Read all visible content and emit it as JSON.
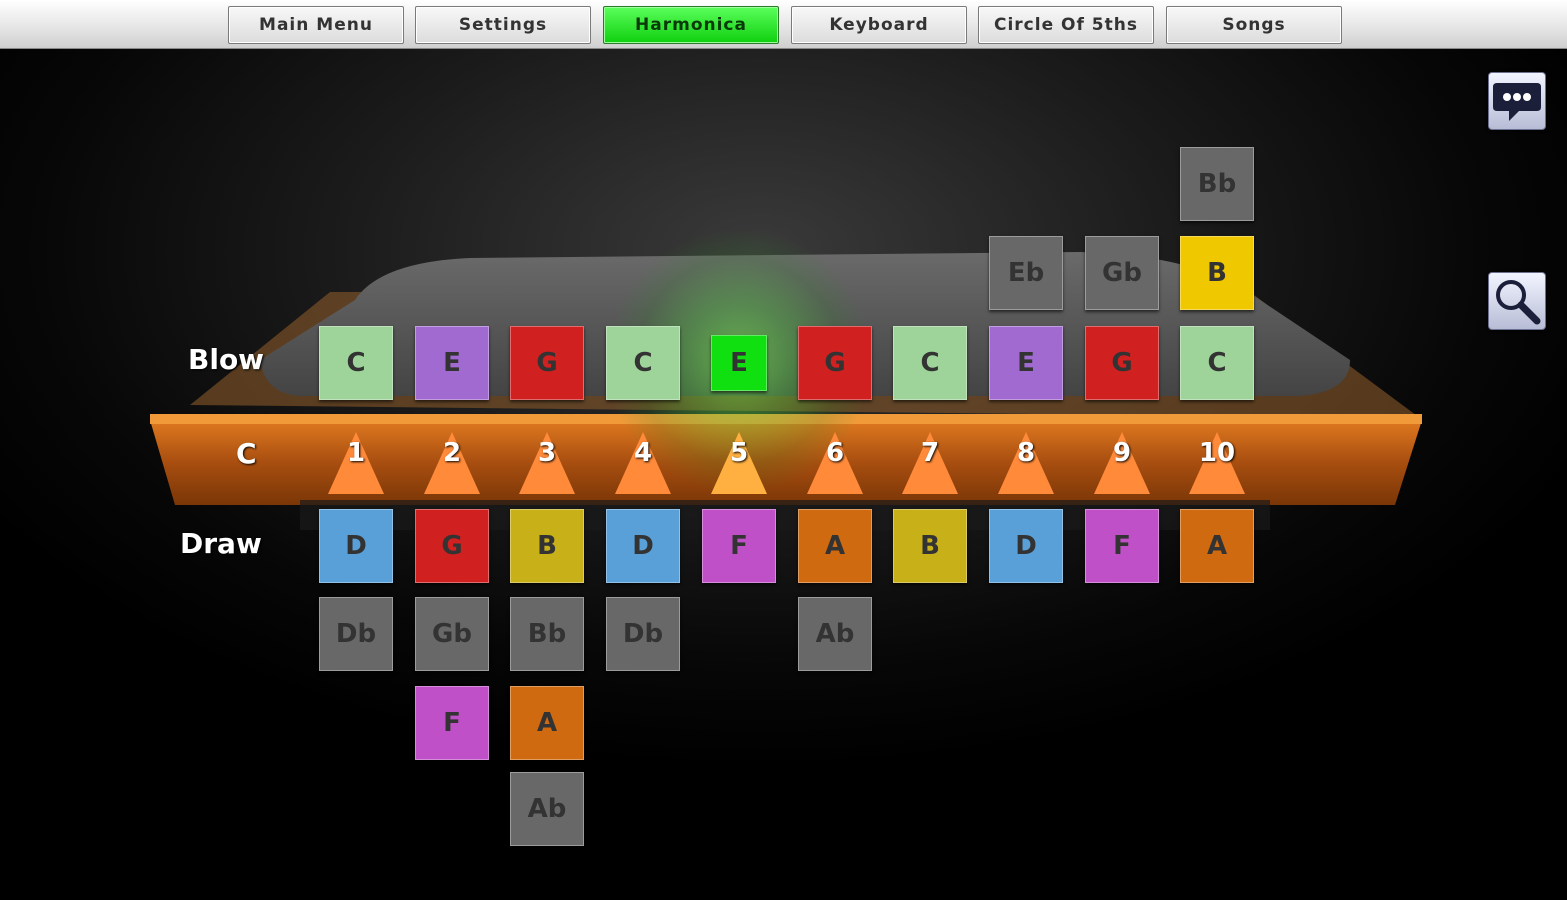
{
  "nav": {
    "buttons": [
      {
        "label": "Main Menu",
        "active": false
      },
      {
        "label": "Settings",
        "active": false
      },
      {
        "label": "Harmonica",
        "active": true
      },
      {
        "label": "Keyboard",
        "active": false
      },
      {
        "label": "Circle Of 5ths",
        "active": false
      },
      {
        "label": "Songs",
        "active": false
      }
    ]
  },
  "side_icons": {
    "chat": "speech-bubble-icon",
    "zoom": "magnifier-icon"
  },
  "harmonica": {
    "key": "C",
    "blow_label": "Blow",
    "draw_label": "Draw",
    "active_hole": 5,
    "holes": [
      {
        "number": "1",
        "blow": "C",
        "draw": "D",
        "blow_bends": [],
        "draw_bends": [
          "Db"
        ]
      },
      {
        "number": "2",
        "blow": "E",
        "draw": "G",
        "blow_bends": [],
        "draw_bends": [
          "Gb",
          "F"
        ]
      },
      {
        "number": "3",
        "blow": "G",
        "draw": "B",
        "blow_bends": [],
        "draw_bends": [
          "Bb",
          "A",
          "Ab"
        ]
      },
      {
        "number": "4",
        "blow": "C",
        "draw": "D",
        "blow_bends": [],
        "draw_bends": [
          "Db"
        ]
      },
      {
        "number": "5",
        "blow": "E",
        "draw": "F",
        "blow_bends": [],
        "draw_bends": []
      },
      {
        "number": "6",
        "blow": "G",
        "draw": "A",
        "blow_bends": [],
        "draw_bends": [
          "Ab"
        ]
      },
      {
        "number": "7",
        "blow": "C",
        "draw": "B",
        "blow_bends": [],
        "draw_bends": []
      },
      {
        "number": "8",
        "blow": "E",
        "draw": "D",
        "blow_bends": [
          "Eb"
        ],
        "draw_bends": []
      },
      {
        "number": "9",
        "blow": "G",
        "draw": "F",
        "blow_bends": [
          "Gb"
        ],
        "draw_bends": []
      },
      {
        "number": "10",
        "blow": "C",
        "draw": "A",
        "blow_bends": [
          "B",
          "Bb"
        ],
        "draw_bends": []
      }
    ]
  },
  "colors": {
    "C": "#9ed49a",
    "E": "#a06ad0",
    "G": "#d02020",
    "D": "#5aa0d8",
    "B": "#c8b018",
    "F": "#c050c8",
    "A": "#d06a10",
    "bend": "#686868",
    "B_bend": "#f0c800",
    "active_blow": "#10e010",
    "nav_active": "#22e022",
    "hole_triangle": "#ff8a3a"
  }
}
